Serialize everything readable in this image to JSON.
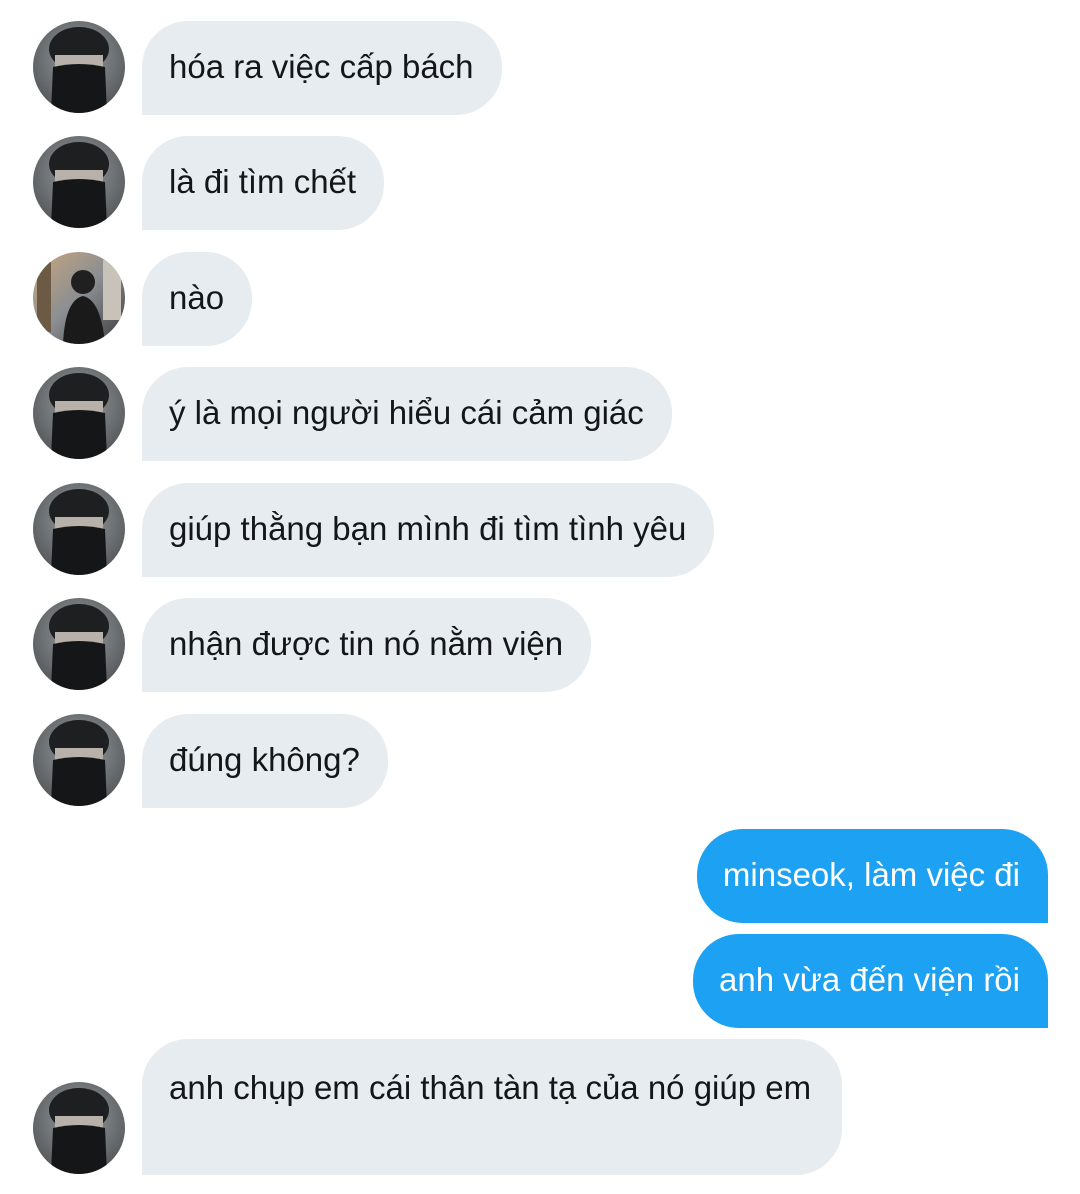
{
  "messages": [
    {
      "side": "in",
      "avatar": "masked",
      "text": "hóa ra việc cấp bách"
    },
    {
      "side": "in",
      "avatar": "masked",
      "text": "là đi tìm chết"
    },
    {
      "side": "in",
      "avatar": "street",
      "text": "nào"
    },
    {
      "side": "in",
      "avatar": "masked",
      "text": "ý là mọi người hiểu cái cảm giác"
    },
    {
      "side": "in",
      "avatar": "masked",
      "text": "giúp thằng bạn mình đi tìm tình yêu"
    },
    {
      "side": "in",
      "avatar": "masked",
      "text": "nhận được tin nó nằm viện"
    },
    {
      "side": "in",
      "avatar": "masked",
      "text": "đúng không?"
    },
    {
      "side": "out",
      "text": "minseok, làm việc đi"
    },
    {
      "side": "out",
      "text": "anh vừa đến viện rồi"
    },
    {
      "side": "in",
      "avatar": "masked",
      "text": "anh chụp em cái thân tàn tạ của nó giúp em"
    }
  ],
  "colors": {
    "incoming_bubble": "#e6ecf0",
    "incoming_text": "#14171a",
    "outgoing_bubble": "#1da1f2",
    "outgoing_text": "#ffffff"
  }
}
